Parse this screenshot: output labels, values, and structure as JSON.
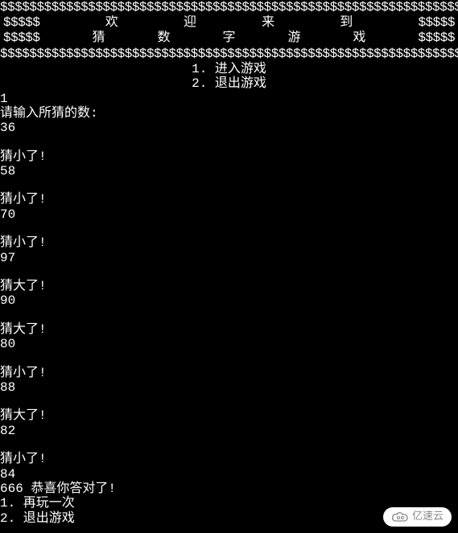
{
  "banner": {
    "dollar_full": "$$$$$$$$$$$$$$$$$$$$$$$$$$$$$$$$$$$$$$$$$$$$$$$$$$$$$$$$$$$$$$$$$$$$$$$$$$$$$$",
    "dollar_edge": "$$$$$",
    "title_chars": [
      "欢",
      "迎",
      "来",
      "到"
    ],
    "subtitle_chars": [
      "猜",
      "数",
      "字",
      "游",
      "戏"
    ]
  },
  "menu": {
    "option1": "1. 进入游戏",
    "option2": "2. 退出游戏"
  },
  "session": {
    "choice": "1",
    "prompt": "请输入所猜的数:",
    "guesses": [
      {
        "value": "36",
        "feedback": "猜小了!"
      },
      {
        "value": "58",
        "feedback": "猜小了!"
      },
      {
        "value": "70",
        "feedback": "猜小了!"
      },
      {
        "value": "97",
        "feedback": "猜大了!"
      },
      {
        "value": "90",
        "feedback": "猜大了!"
      },
      {
        "value": "80",
        "feedback": "猜小了!"
      },
      {
        "value": "88",
        "feedback": "猜大了!"
      },
      {
        "value": "82",
        "feedback": "猜小了!"
      },
      {
        "value": "84",
        "feedback": ""
      }
    ],
    "win_message": "666 恭喜你答对了!",
    "end_menu": {
      "option1": "1. 再玩一次",
      "option2": "2. 退出游戏"
    }
  },
  "watermark": {
    "text": "亿速云"
  }
}
